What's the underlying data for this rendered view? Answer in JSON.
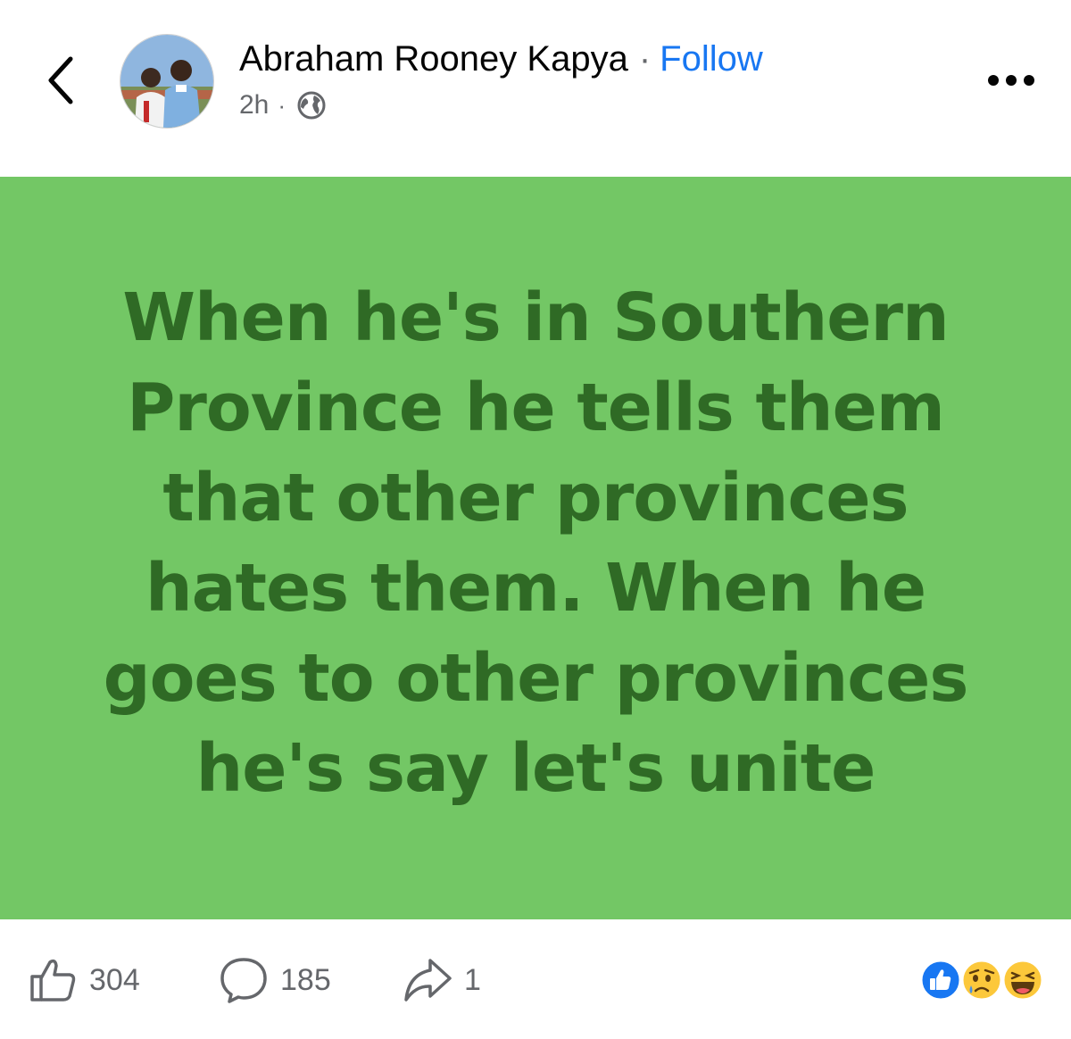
{
  "header": {
    "author_name": "Abraham Rooney Kapya",
    "separator": "·",
    "follow_label": "Follow",
    "time_ago": "2h",
    "meta_separator": "·",
    "audience_icon": "globe-icon",
    "back_icon": "chevron-left-icon",
    "more_icon": "more-dots-icon"
  },
  "post": {
    "lines": [
      "When he's in Southern",
      "Province he tells them",
      "that other provinces",
      "hates them. When he",
      "goes to other provinces",
      "he's say let's unite"
    ],
    "background_color": "#73c765",
    "text_color": "#2f6a25"
  },
  "footer": {
    "like_count": "304",
    "comment_count": "185",
    "share_count": "1",
    "like_icon": "thumbs-up-icon",
    "comment_icon": "comment-bubble-icon",
    "share_icon": "share-arrow-icon",
    "reactions": [
      "like-reaction-icon",
      "sad-reaction-icon",
      "haha-reaction-icon"
    ]
  },
  "colors": {
    "accent": "#1877f2",
    "muted": "#65676b"
  }
}
